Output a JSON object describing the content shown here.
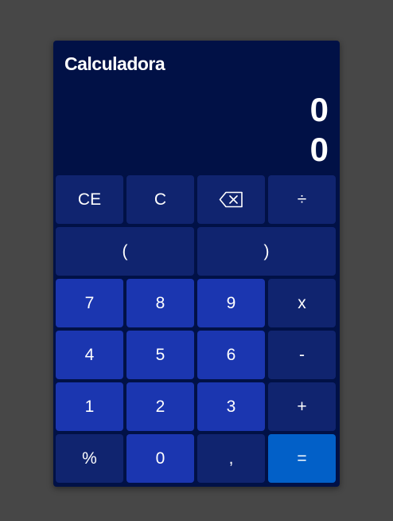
{
  "app": {
    "title": "Calculadora"
  },
  "display": {
    "expression": "0",
    "result": "0"
  },
  "keys": {
    "ce": "CE",
    "clear": "C",
    "backspace_icon": "backspace-icon",
    "divide": "÷",
    "paren_open": "(",
    "paren_close": ")",
    "seven": "7",
    "eight": "8",
    "nine": "9",
    "multiply": "x",
    "four": "4",
    "five": "5",
    "six": "6",
    "minus": "-",
    "one": "1",
    "two": "2",
    "three": "3",
    "plus": "+",
    "percent": "%",
    "zero": "0",
    "comma": ",",
    "equals": "="
  },
  "colors": {
    "panel": "#011146",
    "function_key": "#10246f",
    "number_key": "#1b36b0",
    "equals_key": "#0260c8",
    "background": "#474747"
  }
}
